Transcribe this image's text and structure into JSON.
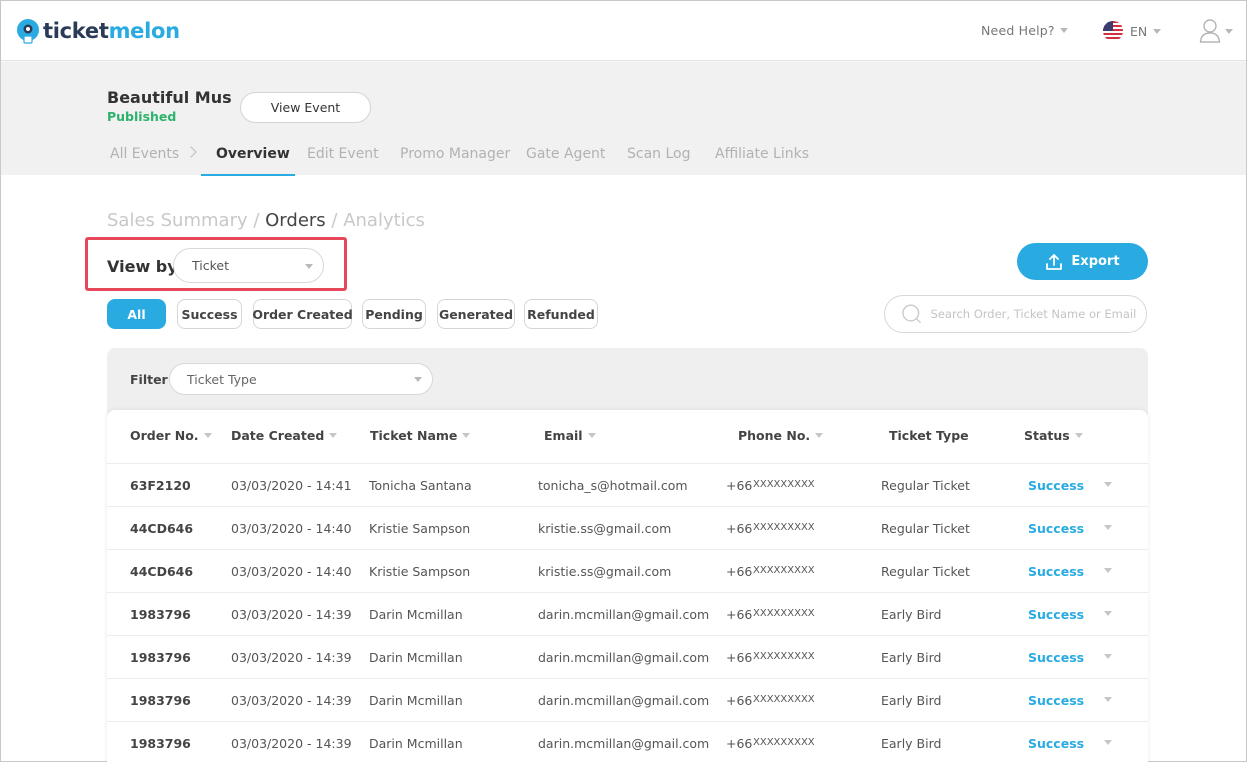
{
  "header": {
    "logo_part1": "ticket",
    "logo_part2": "melon",
    "help_label": "Need Help?",
    "lang_label": "EN"
  },
  "event": {
    "name": "Beautiful Mus",
    "status": "Published",
    "view_button": "View Event"
  },
  "tabs": [
    {
      "label": "All Events"
    },
    {
      "label": "Overview"
    },
    {
      "label": "Edit Event"
    },
    {
      "label": "Promo Manager"
    },
    {
      "label": "Gate Agent"
    },
    {
      "label": "Scan Log"
    },
    {
      "label": "Affiliate Links"
    }
  ],
  "breadcrumb": {
    "item1": "Sales Summary",
    "sep1": " / ",
    "item2": "Orders",
    "sep2": " / ",
    "item3": "Analytics"
  },
  "view_by": {
    "label": "View by",
    "selected": "Ticket"
  },
  "export_label": "Export",
  "status_filters": [
    "All",
    "Success",
    "Order Created",
    "Pending",
    "Generated",
    "Refunded"
  ],
  "search": {
    "placeholder": "Search Order, Ticket Name or Email"
  },
  "filter": {
    "label": "Filter",
    "selected": "Ticket Type"
  },
  "table": {
    "columns": [
      "Order No.",
      "Date Created",
      "Ticket Name",
      "Email",
      "Phone No.",
      "Ticket Type",
      "Status"
    ],
    "rows": [
      {
        "order": "63F2120",
        "date": "03/03/2020 - 14:41",
        "name": "Tonicha Santana",
        "email": "tonicha_s@hotmail.com",
        "phone_code": "+66",
        "phone": "XXXXXXXXX",
        "type": "Regular Ticket",
        "status": "Success"
      },
      {
        "order": "44CD646",
        "date": "03/03/2020 - 14:40",
        "name": "Kristie Sampson",
        "email": "kristie.ss@gmail.com",
        "phone_code": "+66",
        "phone": "XXXXXXXXX",
        "type": "Regular Ticket",
        "status": "Success"
      },
      {
        "order": "44CD646",
        "date": "03/03/2020 - 14:40",
        "name": "Kristie Sampson",
        "email": "kristie.ss@gmail.com",
        "phone_code": "+66",
        "phone": "XXXXXXXXX",
        "type": "Regular Ticket",
        "status": "Success"
      },
      {
        "order": "1983796",
        "date": "03/03/2020 - 14:39",
        "name": "Darin Mcmillan",
        "email": "darin.mcmillan@gmail.com",
        "phone_code": "+66",
        "phone": "XXXXXXXXX",
        "type": "Early Bird",
        "status": "Success"
      },
      {
        "order": "1983796",
        "date": "03/03/2020 - 14:39",
        "name": "Darin Mcmillan",
        "email": "darin.mcmillan@gmail.com",
        "phone_code": "+66",
        "phone": "XXXXXXXXX",
        "type": "Early Bird",
        "status": "Success"
      },
      {
        "order": "1983796",
        "date": "03/03/2020 - 14:39",
        "name": "Darin Mcmillan",
        "email": "darin.mcmillan@gmail.com",
        "phone_code": "+66",
        "phone": "XXXXXXXXX",
        "type": "Early Bird",
        "status": "Success"
      },
      {
        "order": "1983796",
        "date": "03/03/2020 - 14:39",
        "name": "Darin Mcmillan",
        "email": "darin.mcmillan@gmail.com",
        "phone_code": "+66",
        "phone": "XXXXXXXXX",
        "type": "Early Bird",
        "status": "Success"
      }
    ]
  },
  "colors": {
    "accent": "#29abe2",
    "published": "#2db36b",
    "highlight": "#e8475a"
  },
  "icons": [
    "ticketmelon-logo-icon",
    "us-flag-icon",
    "user-icon",
    "chevron-right-icon",
    "upload-icon",
    "search-icon",
    "chevron-down-icon"
  ]
}
